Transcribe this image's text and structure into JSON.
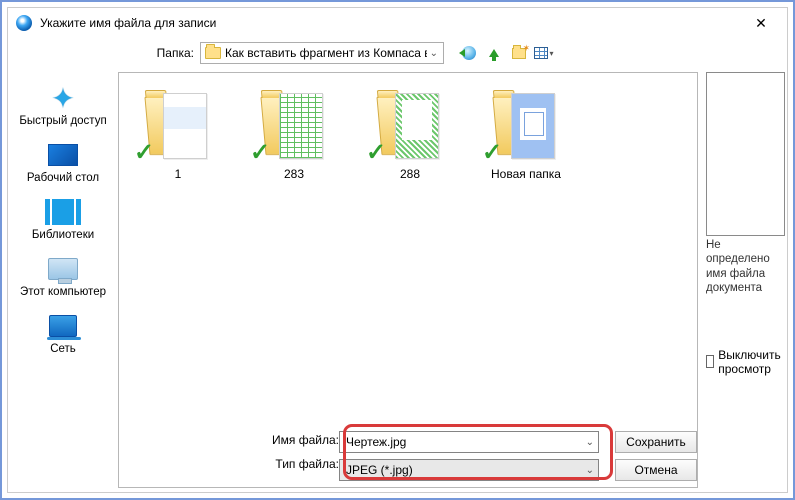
{
  "title": "Укажите имя файла для записи",
  "toprow": {
    "folder_label": "Папка:",
    "folder_value": "Как вставить фрагмент из Компаса в Вор"
  },
  "places": {
    "quick": "Быстрый доступ",
    "desktop": "Рабочий стол",
    "libraries": "Библиотеки",
    "thispc": "Этот компьютер",
    "network": "Сеть"
  },
  "items": {
    "0": "1",
    "1": "283",
    "2": "288",
    "3": "Новая папка"
  },
  "preview": {
    "msg": "Не определено имя файла документа",
    "toggle": "Выключить просмотр"
  },
  "bottom": {
    "name_label": "Имя файла:",
    "type_label": "Тип файла:",
    "name_value": "Чертеж.jpg",
    "type_value": "JPEG (*.jpg)",
    "save": "Сохранить",
    "cancel": "Отмена"
  }
}
